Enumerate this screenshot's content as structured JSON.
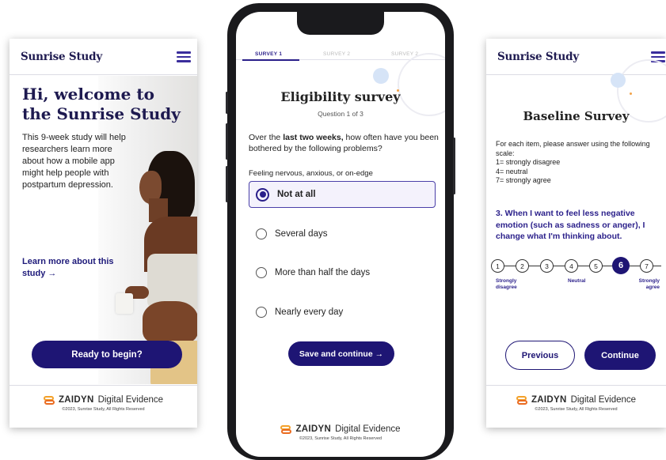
{
  "left_screen": {
    "brand": "Sunrise Study",
    "welcome": "Hi, welcome to the Sunrise Study",
    "intro": "This 9-week study will help researchers learn more about how a mobile app might help people with postpartum depression.",
    "learn_more": "Learn more about this study →",
    "begin_label": "Ready to begin?",
    "footer": {
      "logo_word": "ZAIDYN",
      "logo_rest": "Digital Evidence",
      "copyright": "©2023, Sunrise Study, All Rights Reserved"
    }
  },
  "phone_screen": {
    "tabs": [
      {
        "label": "SURVEY 1",
        "active": true
      },
      {
        "label": "SURVEY 2",
        "active": false
      },
      {
        "label": "SURVEY 2",
        "active": false
      }
    ],
    "title": "Eligibility survey",
    "question_count": "Question 1 of 3",
    "question_pre": "Over the ",
    "question_bold": "last two weeks,",
    "question_post": " how often have you been bothered by the following problems?",
    "sub_question": "Feeling nervous, anxious, or on-edge",
    "options": [
      {
        "label": "Not at all",
        "selected": true
      },
      {
        "label": "Several days",
        "selected": false
      },
      {
        "label": "More than half the days",
        "selected": false
      },
      {
        "label": "Nearly every day",
        "selected": false
      }
    ],
    "save_label": "Save and continue →",
    "footer": {
      "logo_word": "ZAIDYN",
      "logo_rest": "Digital Evidence",
      "copyright": "©2023, Sunrise Study, All Rights Reserved"
    }
  },
  "right_screen": {
    "brand": "Sunrise Study",
    "title": "Baseline Survey",
    "instructions": [
      "For each item, please answer using the following scale:",
      "1= strongly disagree",
      "4= neutral",
      "7= strongly agree"
    ],
    "statement": "3. When I want to feel less negative emotion (such as sadness or anger), I change what I'm thinking about.",
    "scale": {
      "points": [
        "1",
        "2",
        "3",
        "4",
        "5",
        "6",
        "7"
      ],
      "selected": "6",
      "label_left": "Strongly disagree",
      "label_mid": "Neutral",
      "label_right": "Strongly agree"
    },
    "previous_label": "Previous",
    "continue_label": "Continue",
    "footer": {
      "logo_word": "ZAIDYN",
      "logo_rest": "Digital Evidence",
      "copyright": "©2023, Sunrise Study, All Rights Reserved"
    }
  },
  "colors": {
    "primary": "#1e1574",
    "accent_text": "#2a1f8a",
    "logo_orange": "#ea6b20",
    "logo_gold": "#f3a12a"
  },
  "icons": [
    "hamburger-menu-icon",
    "arrow-right-icon",
    "radio-selected-icon",
    "radio-empty-icon",
    "zaidyn-logo-icon"
  ]
}
